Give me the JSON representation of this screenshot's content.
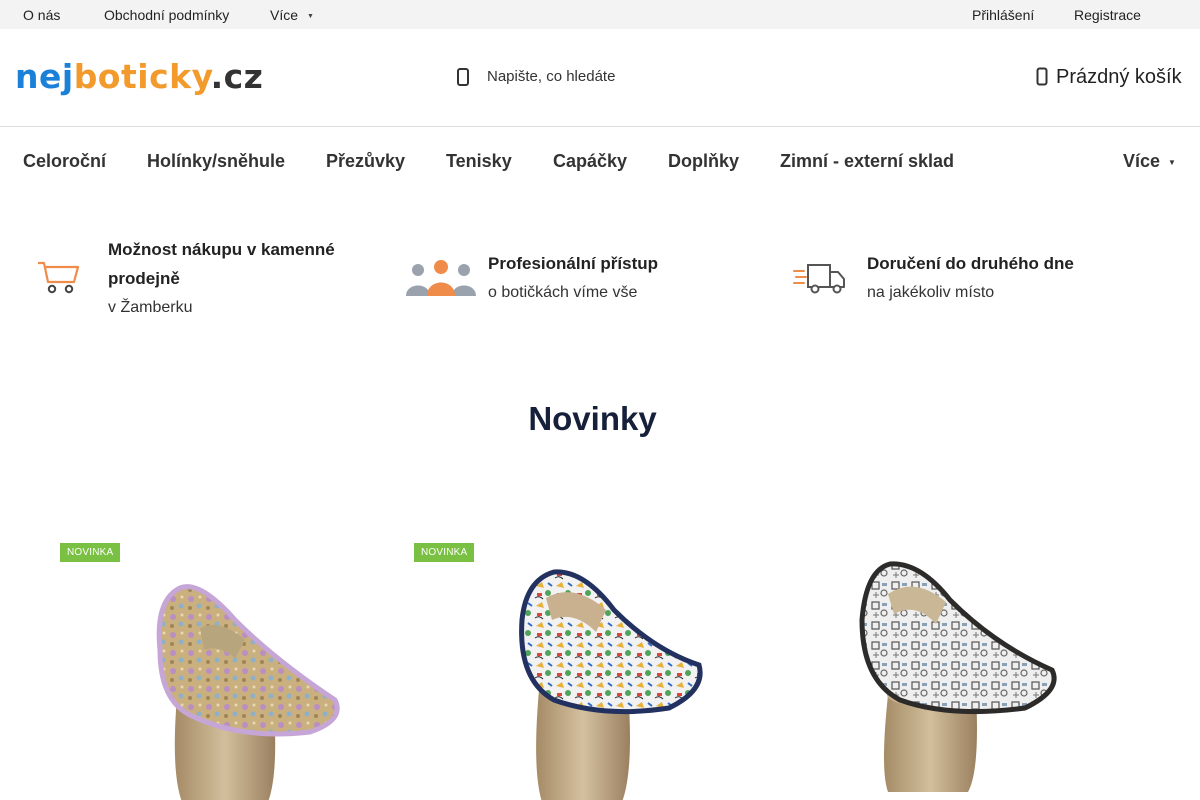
{
  "topbar": {
    "about": "O nás",
    "terms": "Obchodní podmínky",
    "more": "Více",
    "login": "Přihlášení",
    "register": "Registrace"
  },
  "header": {
    "logo_part1": "nej",
    "logo_part2": "boticky",
    "logo_part3": ".cz",
    "search_placeholder": "Napište, co hledáte",
    "cart_label": "Prázdný košík"
  },
  "nav": {
    "items": [
      "Celoroční",
      "Holínky/sněhule",
      "Přezůvky",
      "Tenisky",
      "Capáčky",
      "Doplňky",
      "Zimní - externí sklad"
    ],
    "more": "Více"
  },
  "benefits": [
    {
      "icon": "shopping-cart-icon",
      "title_line1": "Možnost nákupu v kamenné",
      "title_line2": "prodejně",
      "subtitle": "v Žamberku"
    },
    {
      "icon": "people-group-icon",
      "title": "Profesionální přístup",
      "subtitle": "o botičkách víme vše"
    },
    {
      "icon": "delivery-truck-icon",
      "title": "Doručení do druhého dne",
      "subtitle": "na jakékoliv místo"
    }
  ],
  "section": {
    "title": "Novinky"
  },
  "products": [
    {
      "badge": "NOVINKA",
      "pattern": "pastel floral slipper with lilac trim"
    },
    {
      "badge": "NOVINKA",
      "pattern": "white slipper with colorful dinosaur print, navy trim"
    },
    {
      "badge": "",
      "pattern": "white slipper with grey robot print, dark trim"
    }
  ],
  "colors": {
    "logo_blue": "#1b80d7",
    "logo_orange": "#f39a2c",
    "badge_green": "#7ac043",
    "icon_orange": "#f08c4a",
    "topbar_bg": "#f3f3f3"
  }
}
